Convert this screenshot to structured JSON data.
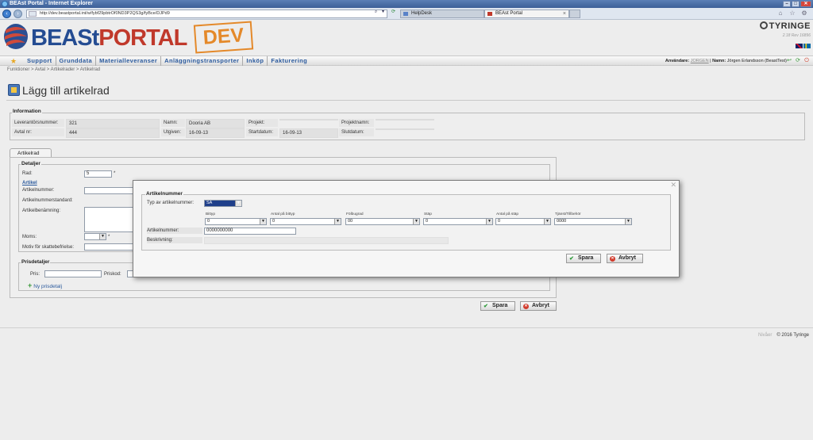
{
  "browser": {
    "window_title": "BEAst Portal - Internet Explorer",
    "url": "http://dev.beastportal.int/w/fybf29pbtrOf0ND3P2QS3g/fyBce/DJPd9",
    "tabs": [
      {
        "label": "HelpDesk"
      },
      {
        "label": "BEAst Portal"
      }
    ]
  },
  "header": {
    "logo_part1": "BEASt",
    "logo_part2": "PORTAL",
    "dev_label": "DEV",
    "brand": "TYRINGE",
    "version": "2.18 Rev 16896"
  },
  "menu": {
    "items": [
      "Support",
      "Grunddata",
      "Materialleveranser",
      "Anläggningstransporter",
      "Inköp",
      "Fakturering"
    ],
    "user_label": "Användare:",
    "user_id": "JORGEN",
    "name_label": "Namn:",
    "user_name": "Jörgen Erlandsson (BeastTest)"
  },
  "breadcrumb": "Funktioner > Avtal > Artikelrader > Artikelrad",
  "page_title": "Lägg till artikelrad",
  "information": {
    "legend": "Information",
    "leverantorsnummer_label": "Leverantörsnummer:",
    "leverantorsnummer_value": "321",
    "namn_label": "Namn:",
    "namn_value": "Dooria AB",
    "projekt_label": "Projekt:",
    "projekt_value": "",
    "projektnamn_label": "Projektnamn:",
    "projektnamn_value": "",
    "avtal_label": "Avtal nr:",
    "avtal_value": "444",
    "utgiven_label": "Utgiven:",
    "utgiven_value": "16-09-13",
    "startdatum_label": "Startdatum:",
    "startdatum_value": "16-09-13",
    "slutdatum_label": "Slutdatum:",
    "slutdatum_value": ""
  },
  "artikelrad": {
    "tab_label": "Artikelrad",
    "detaljer_legend": "Detaljer",
    "rad_label": "Rad:",
    "rad_value": "5",
    "required_mark": "*",
    "artikel_link": "Artikel",
    "artikelnummer_label": "Artikelnummer:",
    "artikelnummerstandard_label": "Artikelnummerstandard:",
    "artikelbenamning_label": "Artikelbenämning:",
    "moms_label": "Moms:",
    "motiv_label": "Motiv för skattebefrielse:",
    "prisdetaljer_legend": "Prisdetaljer",
    "pris_label": "Pris:",
    "priskod_label": "Priskod:",
    "ny_prisdetalj": "Ny prisdetalj",
    "save_label": "Spara",
    "cancel_label": "Avbryt"
  },
  "modal": {
    "legend": "Artikelnummer",
    "typ_label": "Typ av artikelnummer:",
    "typ_value": "SA",
    "columns": [
      {
        "label": "Bittyp",
        "value": "0"
      },
      {
        "label": "Antal på bittyp",
        "value": "0"
      },
      {
        "label": "Fölbugrad",
        "value": "00"
      },
      {
        "label": "Stäp",
        "value": "0"
      },
      {
        "label": "Antal på stäp",
        "value": "0"
      },
      {
        "label": "Tjänst/Tillbehör",
        "value": "0000"
      }
    ],
    "artikelnummer_label": "Artikelnummer:",
    "artikelnummer_value": "0000000000",
    "beskrivning_label": "Beskrivning:",
    "save_label": "Spara",
    "cancel_label": "Avbryt",
    "close_glyph": "✕"
  },
  "footer": {
    "spacer": "Nivåer",
    "copyright": "© 2016 Tyringe"
  }
}
